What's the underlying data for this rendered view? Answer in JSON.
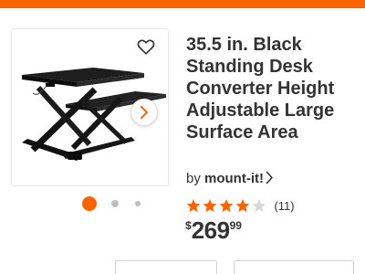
{
  "theme": {
    "accent": "#f96302",
    "star_color": "#f96302",
    "text_color": "#333333",
    "dot_inactive": "#bdbdbd"
  },
  "gallery": {
    "favorite_icon": "heart-outline-icon",
    "next_icon": "chevron-right-icon",
    "product_image": "standing-desk-converter",
    "slide_count": 3,
    "active_slide": 1
  },
  "product": {
    "title": "35.5 in. Black Standing Desk Converter Height Adjustable Large Surface Area",
    "brand_prefix": "by",
    "brand_name": "mount-it!",
    "rating": 4.5,
    "rating_max": 5,
    "review_count": "(11)",
    "price_symbol": "$",
    "price_dollars": "269",
    "price_cents": "99"
  }
}
